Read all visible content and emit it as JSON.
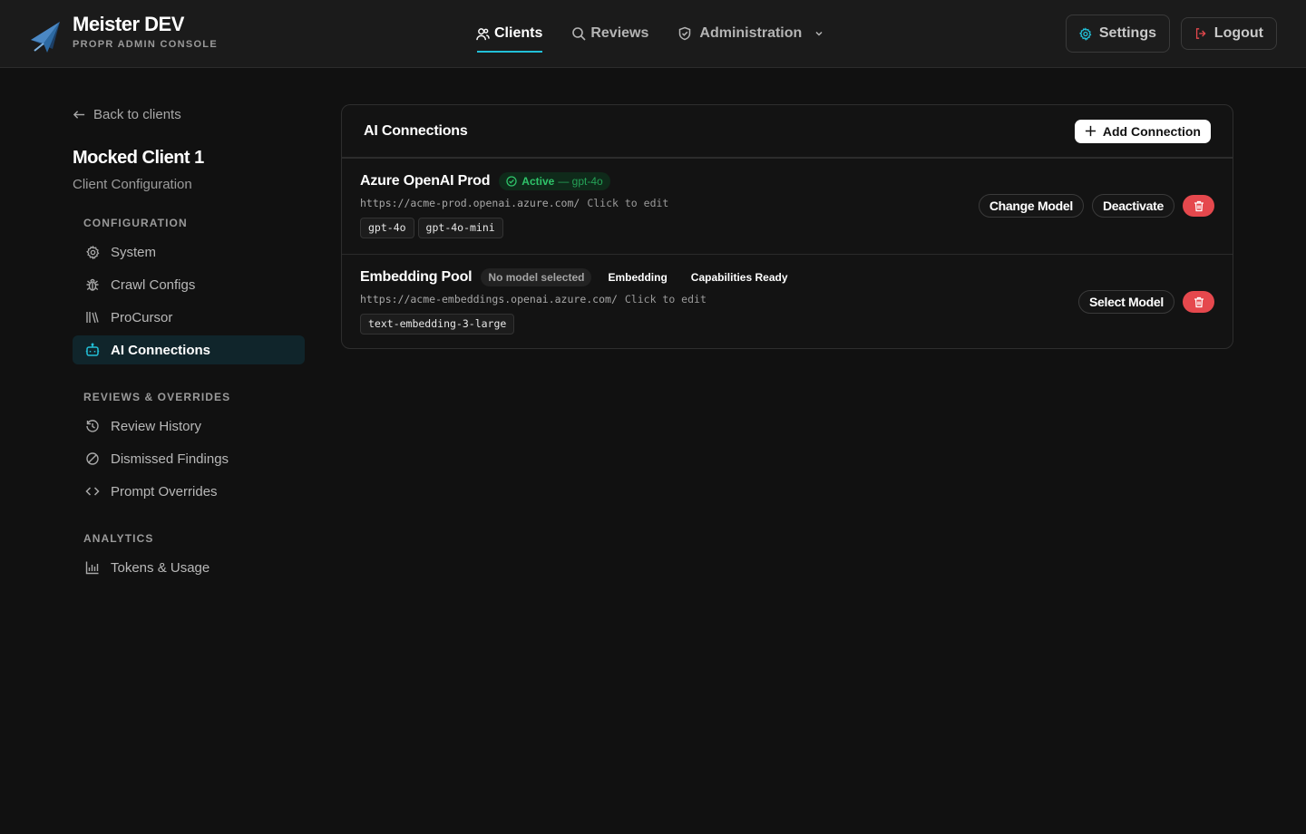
{
  "app": {
    "title": "Meister DEV",
    "subtitle": "PROPR ADMIN CONSOLE"
  },
  "nav": {
    "clients": "Clients",
    "reviews": "Reviews",
    "administration": "Administration"
  },
  "header_actions": {
    "settings": "Settings",
    "logout": "Logout"
  },
  "sidebar": {
    "back": "Back to clients",
    "client_name": "Mocked Client 1",
    "client_sub": "Client Configuration",
    "sections": [
      {
        "label": "CONFIGURATION",
        "items": [
          {
            "label": "System",
            "icon": "gear-icon"
          },
          {
            "label": "Crawl Configs",
            "icon": "bug-icon"
          },
          {
            "label": "ProCursor",
            "icon": "library-icon"
          },
          {
            "label": "AI Connections",
            "icon": "bot-icon",
            "active": true
          }
        ]
      },
      {
        "label": "REVIEWS & OVERRIDES",
        "items": [
          {
            "label": "Review History",
            "icon": "history-icon"
          },
          {
            "label": "Dismissed Findings",
            "icon": "ban-icon"
          },
          {
            "label": "Prompt Overrides",
            "icon": "code-icon"
          }
        ]
      },
      {
        "label": "ANALYTICS",
        "items": [
          {
            "label": "Tokens & Usage",
            "icon": "chart-icon"
          }
        ]
      }
    ]
  },
  "main": {
    "title": "AI Connections",
    "add_button": "Add Connection",
    "connections": [
      {
        "name": "Azure OpenAI Prod",
        "status": "Active",
        "status_model": "— gpt-4o",
        "url": "https://acme-prod.openai.azure.com/",
        "edit_hint": "Click to edit",
        "models": [
          "gpt-4o",
          "gpt-4o-mini"
        ],
        "actions": [
          "Change Model",
          "Deactivate"
        ]
      },
      {
        "name": "Embedding Pool",
        "badges": [
          "No model selected",
          "Embedding",
          "Capabilities Ready"
        ],
        "url": "https://acme-embeddings.openai.azure.com/",
        "edit_hint": "Click to edit",
        "models": [
          "text-embedding-3-large"
        ],
        "actions": [
          "Select Model"
        ]
      }
    ]
  },
  "colors": {
    "accent": "#22c0d8",
    "active_green": "#2fc46a",
    "danger": "#e5484d",
    "background": "#111111"
  }
}
